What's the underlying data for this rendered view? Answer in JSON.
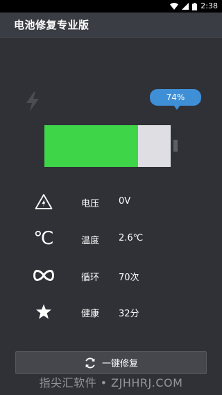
{
  "status_bar": {
    "time": "2:38",
    "battery_label": "",
    "icons": [
      "wifi-icon",
      "signal-icon",
      "battery-icon"
    ]
  },
  "app_bar": {
    "title": "电池修复专业版"
  },
  "battery": {
    "percent_text": "74%",
    "level": 0.74,
    "fill_color": "#3fd548",
    "empty_color": "#dfdfe3",
    "bubble_color": "#3f8fd6"
  },
  "info": [
    {
      "icon": "warning-icon",
      "label": "电压",
      "value": "0V"
    },
    {
      "icon": "celsius-icon",
      "label": "温度",
      "value": "2.6℃"
    },
    {
      "icon": "infinity-icon",
      "label": "循环",
      "value": "70次"
    },
    {
      "icon": "star-icon",
      "label": "健康",
      "value": "32分"
    }
  ],
  "repair": {
    "label": "一键修复",
    "icon": "refresh-icon"
  },
  "watermark": {
    "text": "指尖汇软件 • ZJHHRJ.COM"
  }
}
